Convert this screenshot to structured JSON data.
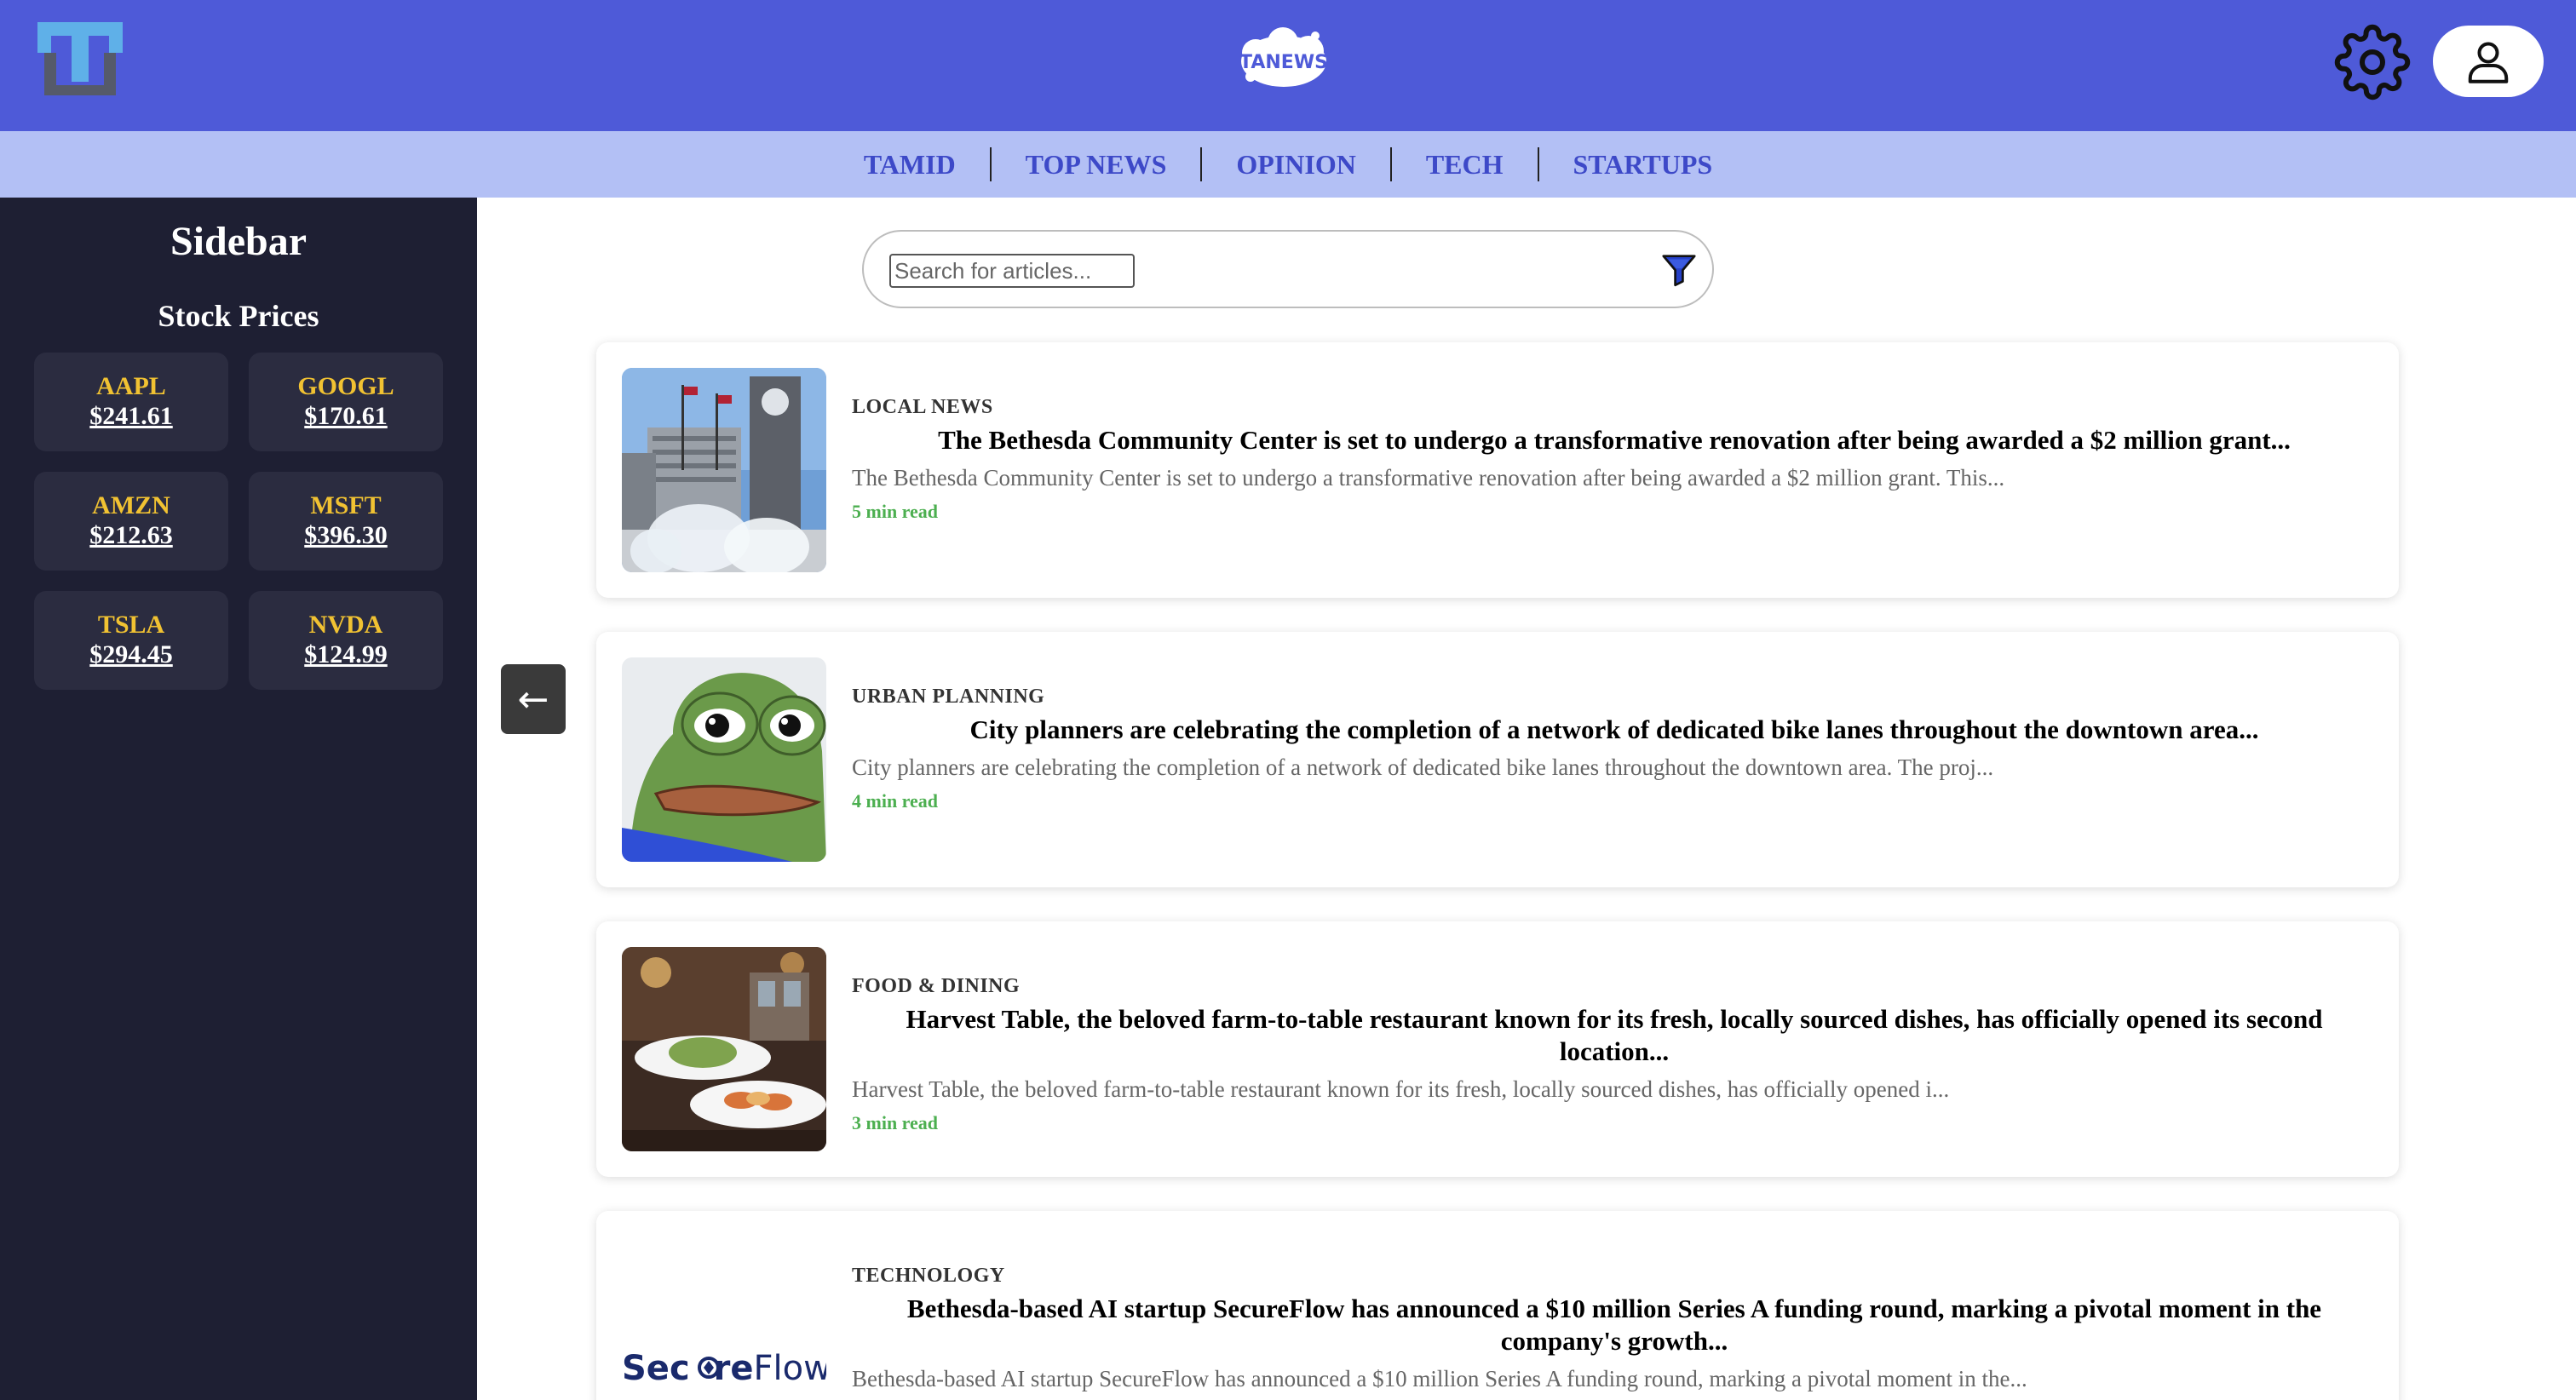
{
  "header": {
    "logo_left_letter": "T",
    "logo_center_text": "TANEWS",
    "brand_color": "#4e5ad8"
  },
  "nav": {
    "items": [
      {
        "label": "TAMID"
      },
      {
        "label": "TOP NEWS"
      },
      {
        "label": "OPINION"
      },
      {
        "label": "TECH"
      },
      {
        "label": "STARTUPS"
      }
    ]
  },
  "sidebar": {
    "title": "Sidebar",
    "stocks_title": "Stock Prices",
    "stocks": [
      {
        "symbol": "AAPL",
        "price": "$241.61"
      },
      {
        "symbol": "GOOGL",
        "price": "$170.61"
      },
      {
        "symbol": "AMZN",
        "price": "$212.63"
      },
      {
        "symbol": "MSFT",
        "price": "$396.30"
      },
      {
        "symbol": "TSLA",
        "price": "$294.45"
      },
      {
        "symbol": "NVDA",
        "price": "$124.99"
      }
    ]
  },
  "collapse_button": {
    "label": "←"
  },
  "search": {
    "placeholder": "Search for articles...",
    "value": ""
  },
  "articles": [
    {
      "category": "LOCAL NEWS",
      "title": "The Bethesda Community Center is set to undergo a transformative renovation after being awarded a $2 million grant...",
      "excerpt": "The Bethesda Community Center is set to undergo a transformative renovation after being awarded a $2 million grant. This...",
      "read_time": "5 min read"
    },
    {
      "category": "URBAN PLANNING",
      "title": "City planners are celebrating the completion of a network of dedicated bike lanes throughout the downtown area...",
      "excerpt": "City planners are celebrating the completion of a network of dedicated bike lanes throughout the downtown area. The proj...",
      "read_time": "4 min read"
    },
    {
      "category": "FOOD & DINING",
      "title": "Harvest Table, the beloved farm-to-table restaurant known for its fresh, locally sourced dishes, has officially opened its second location...",
      "excerpt": "Harvest Table, the beloved farm-to-table restaurant known for its fresh, locally sourced dishes, has officially opened i...",
      "read_time": "3 min read"
    },
    {
      "category": "TECHNOLOGY",
      "title": "Bethesda-based AI startup SecureFlow has announced a $10 million Series A funding round, marking a pivotal moment in the company's growth...",
      "excerpt": "Bethesda-based AI startup SecureFlow has announced a $10 million Series A funding round, marking a pivotal moment in the...",
      "read_time": "",
      "logo_text_1": "Sec",
      "logo_text_2": "re",
      "logo_text_3": "Flow"
    }
  ]
}
